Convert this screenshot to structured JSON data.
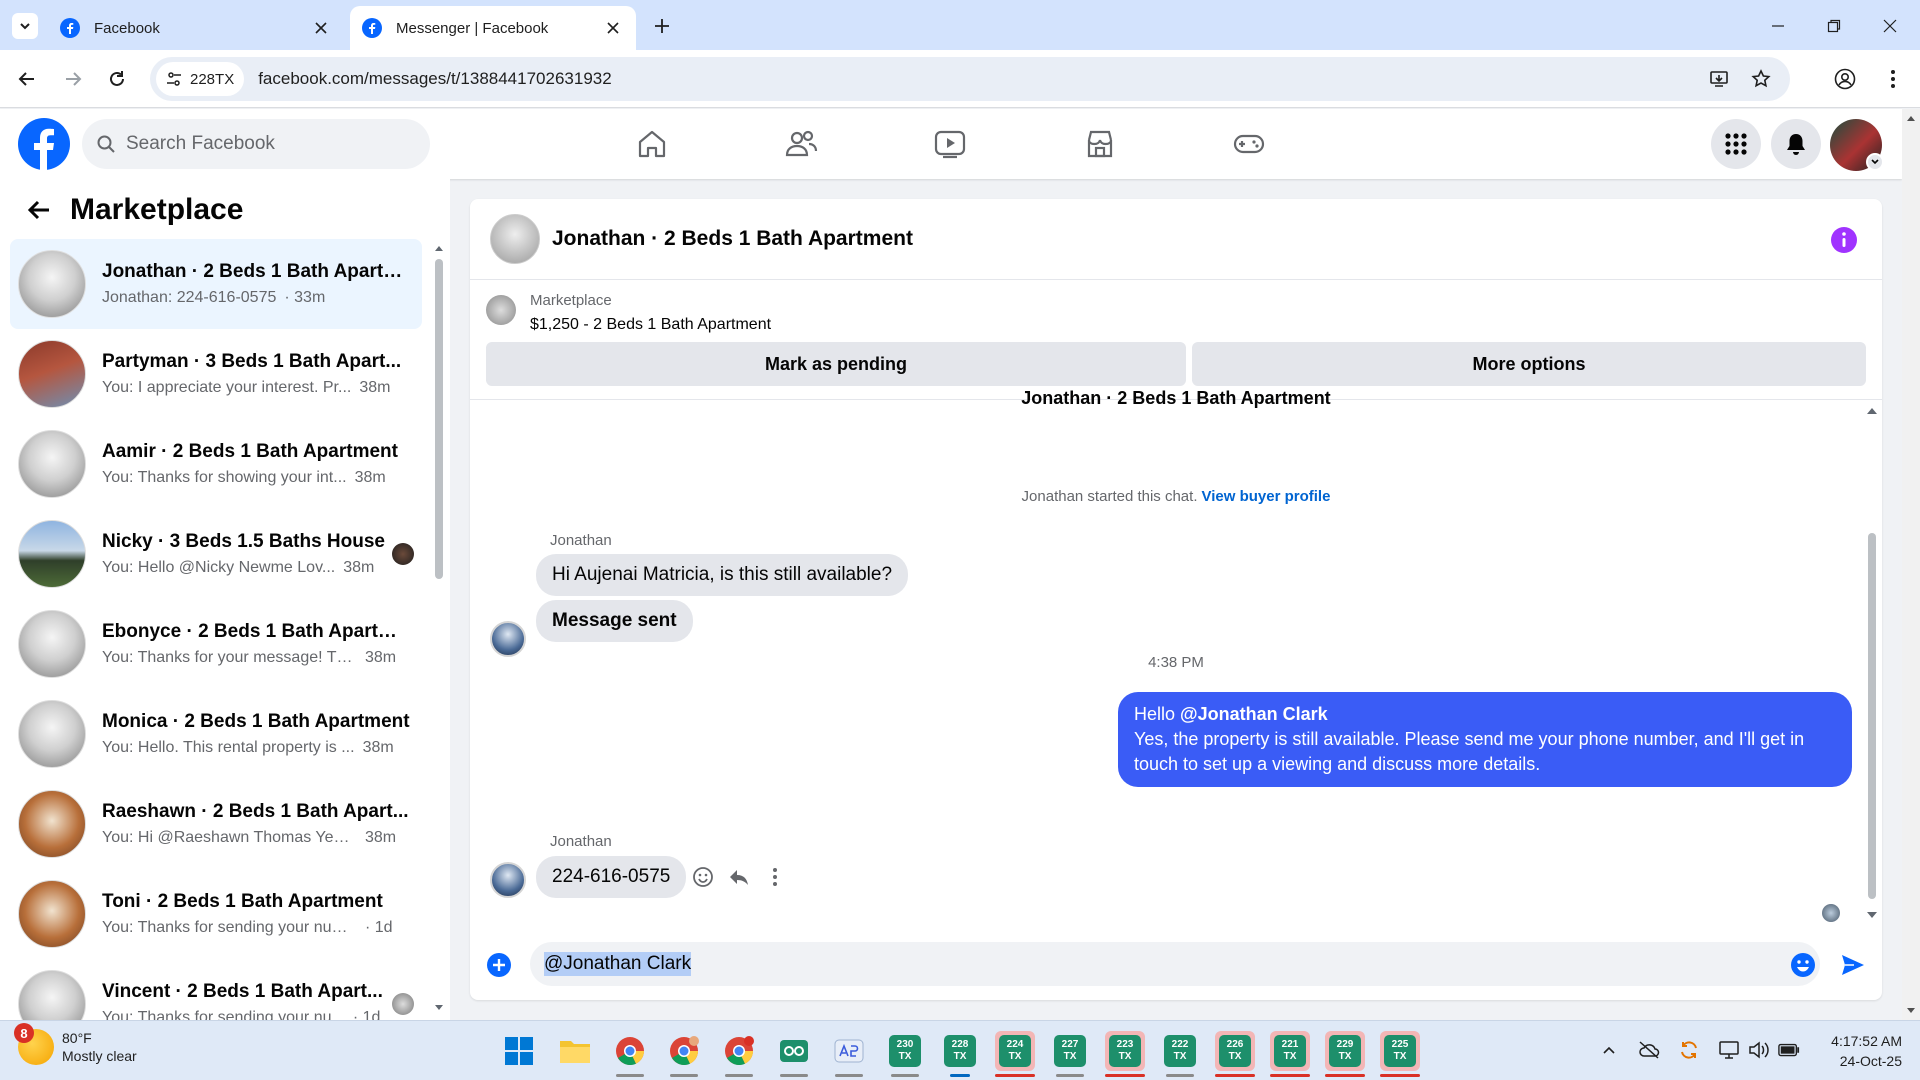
{
  "browser": {
    "tabs": [
      {
        "title": "Facebook",
        "active": false
      },
      {
        "title": "Messenger | Facebook",
        "active": true
      }
    ],
    "site_chip": "228TX",
    "url": "facebook.com/messages/t/1388441702631932"
  },
  "fb": {
    "search_placeholder": "Search Facebook"
  },
  "sidebar": {
    "title": "Marketplace",
    "conversations": [
      {
        "name": "Jonathan · 2 Beds 1 Bath Apartm...",
        "preview": "Jonathan: 224-616-0575",
        "time": "· 33m",
        "thumb": "apartment"
      },
      {
        "name": "Partyman · 3 Beds 1 Bath Apart...",
        "preview": "You: I appreciate your interest. Pr...",
        "time": "38m",
        "thumb": "brick"
      },
      {
        "name": "Aamir · 2 Beds 1 Bath Apartment",
        "preview": "You: Thanks for showing your int...",
        "time": "38m",
        "thumb": "apartment"
      },
      {
        "name": "Nicky · 3 Beds 1.5 Baths House",
        "preview": "You: Hello @Nicky Newme Lov...",
        "time": "38m",
        "thumb": "house"
      },
      {
        "name": "Ebonyce · 2 Beds 1 Bath Apartm...",
        "preview": "You: Thanks for your message! Th...",
        "time": "38m",
        "thumb": "apartment"
      },
      {
        "name": "Monica · 2 Beds 1 Bath Apartment",
        "preview": "You: Hello. This rental property is ...",
        "time": "38m",
        "thumb": "apartment"
      },
      {
        "name": "Raeshawn · 2 Beds 1 Bath Apart...",
        "preview": "You: Hi @Raeshawn Thomas Yes, ...",
        "time": "38m",
        "thumb": "kitchen"
      },
      {
        "name": "Toni · 2 Beds 1 Bath Apartment",
        "preview": "You: Thanks for sending your numb...",
        "time": "· 1d",
        "thumb": "kitchen"
      },
      {
        "name": "Vincent · 2 Beds 1 Bath Apart...",
        "preview": "You: Thanks for sending your nu...",
        "time": "· 1d",
        "thumb": "apartment"
      }
    ]
  },
  "chat": {
    "title": "Jonathan · 2 Beds 1 Bath Apartment",
    "listing_source": "Marketplace",
    "listing_title": "$1,250 - 2 Beds 1 Bath Apartment",
    "mark_pending": "Mark as pending",
    "more_options": "More options",
    "cut_title": "Jonathan · 2 Beds 1 Bath Apartment",
    "system_text": "Jonathan started this chat.",
    "system_link": "View buyer profile",
    "sender_name_1": "Jonathan",
    "msg_1": "Hi Aujenai Matricia, is this still available?",
    "msg_2": "Message sent",
    "time_1": "4:38 PM",
    "out_greeting": "Hello",
    "out_mention": "@Jonathan Clark",
    "out_body": "Yes, the property is still available. Please send me your phone number, and I'll get in touch to set up a viewing and discuss more details.",
    "sender_name_2": "Jonathan",
    "msg_3": "224-616-0575",
    "composer_value": "@Jonathan Clark"
  },
  "taskbar": {
    "weather_badge": "8",
    "temperature": "80°F",
    "condition": "Mostly clear",
    "apps": [
      {
        "label": "230\nTX",
        "highlight": false
      },
      {
        "label": "228\nTX",
        "highlight": false
      },
      {
        "label": "224\nTX",
        "highlight": true
      },
      {
        "label": "227\nTX",
        "highlight": false
      },
      {
        "label": "223\nTX",
        "highlight": true
      },
      {
        "label": "222\nTX",
        "highlight": false
      },
      {
        "label": "226\nTX",
        "highlight": true
      },
      {
        "label": "221\nTX",
        "highlight": true
      },
      {
        "label": "229\nTX",
        "highlight": true
      },
      {
        "label": "225\nTX",
        "highlight": true
      }
    ],
    "time": "4:17:52 AM",
    "date": "24-Oct-25"
  },
  "colors": {
    "fb_blue": "#0866ff",
    "outgoing_bubble": "#3a5cf6",
    "info_purple": "#a033ff"
  }
}
